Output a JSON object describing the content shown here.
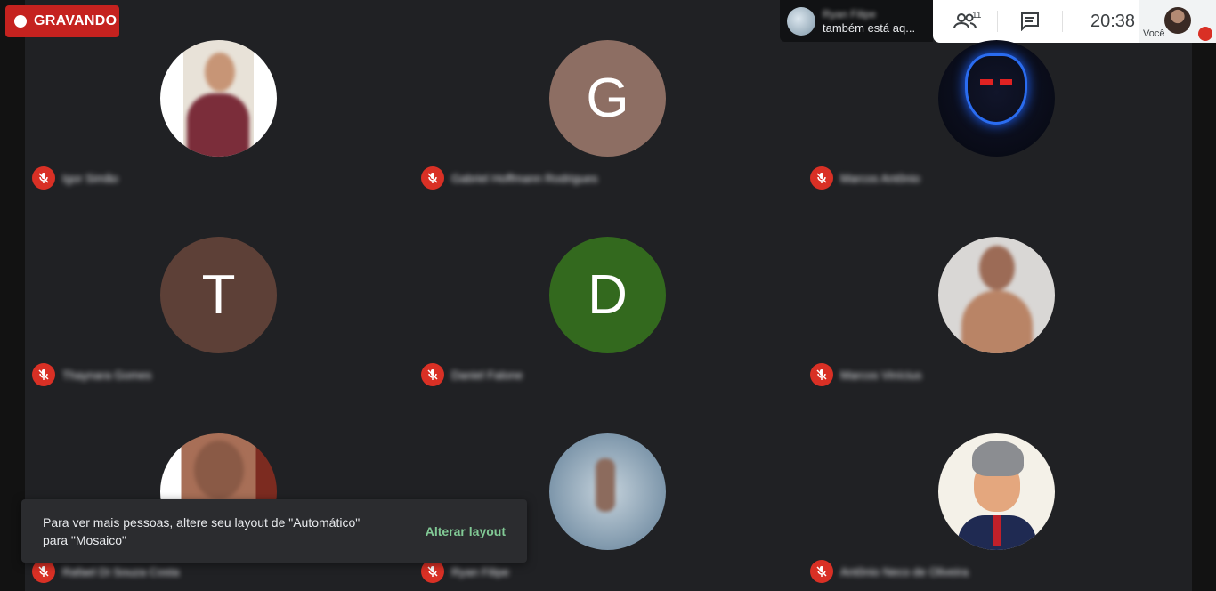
{
  "recording": {
    "label": "GRAVANDO"
  },
  "notification": {
    "name": "Ryan Filipe",
    "message": "também está aq..."
  },
  "topbar": {
    "participant_count": "11",
    "clock": "20:38",
    "self_label": "Você"
  },
  "tiles": [
    {
      "name": "Igor Simão",
      "initial": ""
    },
    {
      "name": "Gabriel Hoffmann Rodrigues",
      "initial": "G",
      "color": "#8d6e63"
    },
    {
      "name": "Marcos Antônio",
      "initial": ""
    },
    {
      "name": "Thaynara Gomes",
      "initial": "T",
      "color": "#5d4037"
    },
    {
      "name": "Daniel Falone",
      "initial": "D",
      "color": "#33691e"
    },
    {
      "name": "Marcos Vinícius",
      "initial": ""
    },
    {
      "name": "Rafael Di Souza Costa",
      "initial": ""
    },
    {
      "name": "Ryan Filipe",
      "initial": ""
    },
    {
      "name": "Antônio Neco de Oliveira",
      "initial": ""
    }
  ],
  "toast": {
    "message": "Para ver mais pessoas, altere seu layout de \"Automático\" para \"Mosaico\"",
    "action": "Alterar layout"
  },
  "colors": {
    "mute": "#d93025",
    "record": "#c5221f",
    "action": "#81c995"
  }
}
